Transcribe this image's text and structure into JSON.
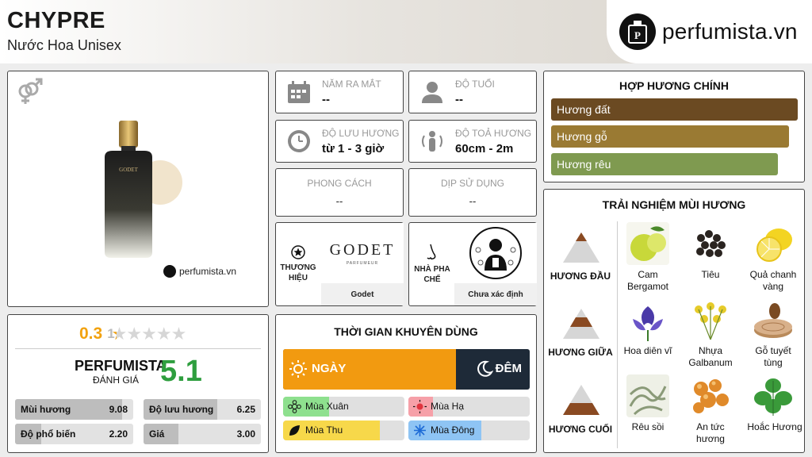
{
  "header": {
    "title": "CHYPRE",
    "subtitle": "Nước Hoa Unisex",
    "logo_text": "perfumista.vn"
  },
  "product": {
    "watermark": "perfumista.vn",
    "gender_icon": "unisex-gender-icon",
    "bottle_text": "GODET"
  },
  "info": {
    "release_label": "NĂM RA MẮT",
    "release_value": "--",
    "age_label": "ĐỘ TUỔI",
    "age_value": "--",
    "longevity_label": "ĐỘ LƯU HƯƠNG",
    "longevity_value": "từ 1 - 3 giờ",
    "sillage_label": "ĐỘ TOẢ HƯƠNG",
    "sillage_value": "60cm - 2m",
    "style_label": "PHONG CÁCH",
    "style_value": "--",
    "occasion_label": "DỊP SỬ DỤNG",
    "occasion_value": "--"
  },
  "brand": {
    "label_line1": "THƯƠNG",
    "label_line2": "HIỆU",
    "logo_main": "GODET",
    "logo_sub": "PARFUMEUR",
    "name": "Godet"
  },
  "perfumer": {
    "label_line1": "NHÀ PHA",
    "label_line2": "CHẾ",
    "name": "Chưa xác định"
  },
  "rating": {
    "user_score": "0.3",
    "user_score_suffix": "1",
    "stars_filled": 0.06,
    "stars_total": 5,
    "brand_label": "PERFUMISTA",
    "sub_label": "ĐÁNH GIÁ",
    "score": "5.1",
    "score_color": "#2e9e3e",
    "bars": [
      {
        "label": "Mùi hương",
        "value": "9.08",
        "fraction": 0.908
      },
      {
        "label": "Độ lưu hương",
        "value": "6.25",
        "fraction": 0.625
      },
      {
        "label": "Độ phổ biến",
        "value": "2.20",
        "fraction": 0.22
      },
      {
        "label": "Giá",
        "value": "3.00",
        "fraction": 0.3
      }
    ]
  },
  "time": {
    "title": "THỜI GIAN KHUYÊN DÙNG",
    "day_label": "NGÀY",
    "night_label": "ĐÊM",
    "day_fraction": 0.7,
    "day_color": "#f29a10",
    "night_color": "#1e2a38",
    "seasons": [
      {
        "label": "Mùa Xuân",
        "fraction": 0.38,
        "color": "#8ee08e",
        "icon": "flower-icon"
      },
      {
        "label": "Mùa Hạ",
        "fraction": 0.2,
        "color": "#f6a0a8",
        "icon": "sun-icon"
      },
      {
        "label": "Mùa Thu",
        "fraction": 0.8,
        "color": "#f7d84a",
        "icon": "leaf-icon"
      },
      {
        "label": "Mùa Đông",
        "fraction": 0.6,
        "color": "#8ec4f4",
        "icon": "snowflake-icon"
      }
    ]
  },
  "accords": {
    "title": "HỢP HƯƠNG CHÍNH",
    "items": [
      {
        "label": "Hương đất",
        "fraction": 1.0,
        "color": "#6b4a22"
      },
      {
        "label": "Hương gỗ",
        "fraction": 0.965,
        "color": "#9a7a33"
      },
      {
        "label": "Hương rêu",
        "fraction": 0.92,
        "color": "#7f9a50"
      }
    ]
  },
  "notes": {
    "title": "TRẢI NGHIỆM MÙI HƯƠNG",
    "top_label": "HƯƠNG ĐẦU",
    "middle_label": "HƯƠNG GIỮA",
    "base_label": "HƯƠNG CUỐI",
    "top": [
      {
        "line1": "Cam",
        "line2": "Bergamot"
      },
      {
        "line1": "Tiêu",
        "line2": ""
      },
      {
        "line1": "Quả chanh",
        "line2": "vàng"
      }
    ],
    "middle": [
      {
        "line1": "Hoa diên vĩ",
        "line2": ""
      },
      {
        "line1": "Nhựa",
        "line2": "Galbanum"
      },
      {
        "line1": "Gỗ tuyết",
        "line2": "tùng"
      }
    ],
    "base": [
      {
        "line1": "Rêu sồi",
        "line2": ""
      },
      {
        "line1": "An tức",
        "line2": "hương"
      },
      {
        "line1": "Hoắc Hương",
        "line2": ""
      }
    ]
  }
}
